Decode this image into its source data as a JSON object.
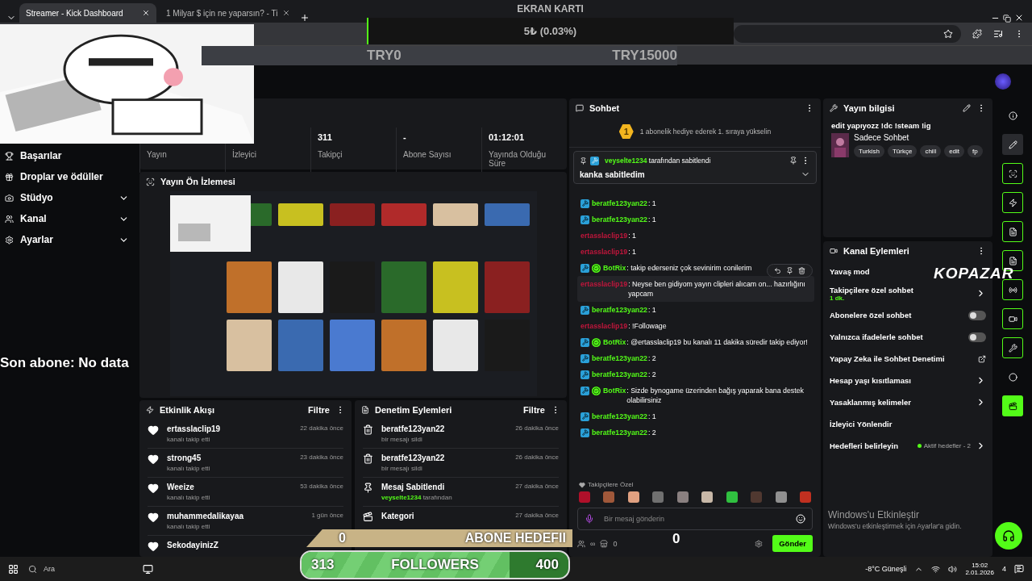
{
  "browser": {
    "tabs": [
      {
        "title": "Streamer - Kick Dashboard",
        "selected": true
      },
      {
        "title": "1 Milyar $ için ne yaparsın? - Ti",
        "selected": false
      }
    ]
  },
  "overlay": {
    "gpu_title": "EKRAN KARTI",
    "gpu_amount": "5₺ (0.03%)",
    "gpu_bar": {
      "level": 0.003
    },
    "min": "TRY0",
    "max": "TRY15000",
    "last_sub": "Son abone: No data",
    "sub_count": "0",
    "sub_label": "ABONE HEDEFII",
    "follow_count": "313",
    "follow_label": "FOLLOWERS",
    "follow_target": "400",
    "follow_bar": {
      "level": 0.78
    },
    "counter": "0",
    "sponsor": "KOPAZAR"
  },
  "sidebar": {
    "items": [
      {
        "label": "Başarılar",
        "expandable": false
      },
      {
        "label": "Droplar ve ödüller",
        "expandable": false
      },
      {
        "label": "Stüdyo",
        "expandable": true
      },
      {
        "label": "Kanal",
        "expandable": true
      },
      {
        "label": "Ayarlar",
        "expandable": true
      }
    ]
  },
  "stats": [
    {
      "label": "Yayın"
    },
    {
      "label": "İzleyici"
    },
    {
      "value": "311",
      "label": "Takipçi"
    },
    {
      "value": "-",
      "label": "Abone Sayısı"
    },
    {
      "value": "01:12:01",
      "label": "Yayında Olduğu Süre"
    }
  ],
  "preview": {
    "title": "Yayın Ön İzlemesi",
    "kind": "picture"
  },
  "events": {
    "title": "Etkinlik Akışı",
    "filter": "Filtre",
    "items": [
      {
        "user": "ertasslaclip19",
        "action": "kanalı takip etti",
        "time": "22 dakika önce"
      },
      {
        "user": "strong45",
        "action": "kanalı takip etti",
        "time": "23 dakika önce"
      },
      {
        "user": "Weeize",
        "action": "kanalı takip etti",
        "time": "53 dakika önce"
      },
      {
        "user": "muhammedalikayaa",
        "action": "kanalı takip etti",
        "time": "1 gün önce"
      },
      {
        "user": "SekodayinizZ"
      }
    ]
  },
  "moderation": {
    "title": "Denetim Eylemleri",
    "filter": "Filtre",
    "items": [
      {
        "kind": "delete",
        "title": "beratfe123yan22",
        "detail": "bir mesajı sildi",
        "time": "26 dakika önce"
      },
      {
        "kind": "delete",
        "title": "beratfe123yan22",
        "detail": "bir mesajı sildi",
        "time": "26 dakika önce"
      },
      {
        "kind": "pin",
        "title": "Mesaj Sabitlendi",
        "user": "veyselte1234",
        "detail": "tarafından",
        "time": "27 dakika önce"
      },
      {
        "kind": "category",
        "title": "Kategori",
        "time": "27 dakika önce"
      }
    ]
  },
  "chat": {
    "title": "Sohbet",
    "rank": "1",
    "rank_text": "1 abonelik hediye ederek 1. sıraya yükselin",
    "pinned": {
      "user": "veyselte1234",
      "suffix": "tarafından sabitlendi",
      "text": "kanka sabitledim"
    },
    "messages": [
      {
        "user": "beratfe123yan22",
        "text": ": 1",
        "color": "#53fc18",
        "mod": true,
        "verified": false,
        "hovered": false
      },
      {
        "user": "beratfe123yan22",
        "text": ": 1",
        "color": "#53fc18",
        "mod": true,
        "verified": false,
        "hovered": false
      },
      {
        "user": "ertasslaclip19",
        "text": ": 1",
        "color": "#c0163c",
        "mod": false,
        "verified": false,
        "hovered": false
      },
      {
        "user": "ertasslaclip19",
        "text": ": 1",
        "color": "#c0163c",
        "mod": false,
        "verified": false,
        "hovered": false
      },
      {
        "user": "BotRix",
        "text": ": takip ederseniz çok sevinirim conilerim",
        "color": "#53fc18",
        "mod": true,
        "verified": true,
        "hovered": false
      },
      {
        "user": "ertasslaclip19",
        "text": ": Neyse ben gidiyom yayın clipleri alıcam on... hazırlığını yapcam",
        "color": "#c0163c",
        "mod": false,
        "verified": false,
        "hovered": true
      },
      {
        "user": "beratfe123yan22",
        "text": ": 1",
        "color": "#53fc18",
        "mod": true,
        "verified": false,
        "hovered": false
      },
      {
        "user": "ertasslaclip19",
        "text": ": !Followage",
        "color": "#c0163c",
        "mod": false,
        "verified": false,
        "hovered": false
      },
      {
        "user": "BotRix",
        "text": ": @ertasslaclip19 bu kanalı 11 dakika süredir takip ediyor!",
        "color": "#53fc18",
        "mod": true,
        "verified": true,
        "hovered": false
      },
      {
        "user": "beratfe123yan22",
        "text": ": 2",
        "color": "#53fc18",
        "mod": true,
        "verified": false,
        "hovered": false
      },
      {
        "user": "beratfe123yan22",
        "text": ": 2",
        "color": "#53fc18",
        "mod": true,
        "verified": false,
        "hovered": false
      },
      {
        "user": "BotRix",
        "text": ": Sizde bynogame üzerinden bağış yaparak bana destek olabilirsiniz",
        "color": "#53fc18",
        "mod": true,
        "verified": true,
        "hovered": false
      },
      {
        "user": "beratfe123yan22",
        "text": ": 1",
        "color": "#53fc18",
        "mod": true,
        "verified": false,
        "hovered": false
      },
      {
        "user": "beratfe123yan22",
        "text": ": 2",
        "color": "#53fc18",
        "mod": true,
        "verified": false,
        "hovered": false
      }
    ],
    "emotes_title": "Takipçilere Özel",
    "emotes": [
      {
        "color": "#b0102a"
      },
      {
        "color": "#a0583a"
      },
      {
        "color": "#e0a080"
      },
      {
        "color": "#707070"
      },
      {
        "color": "#8a8080"
      },
      {
        "color": "#c8b8a8"
      },
      {
        "color": "#30c040"
      },
      {
        "color": "#503830"
      },
      {
        "color": "#909090"
      },
      {
        "color": "#c03020"
      }
    ],
    "placeholder": "Bir mesaj gönderin",
    "points": "∞",
    "shop_count": "0",
    "send": "Gönder"
  },
  "stream_info": {
    "title": "Yayın bilgisi",
    "stream_title": "edit yapıyozz !dc !steam !ig",
    "category": "Sadece Sohbet",
    "tags": [
      "Turkish",
      "Türkçe",
      "chill",
      "edit",
      "fp"
    ]
  },
  "channel_actions": {
    "title": "Kanal Eylemleri",
    "items": [
      {
        "kind": "plain",
        "label": "Yavaş mod"
      },
      {
        "kind": "link",
        "label": "Takipçilere özel sohbet",
        "sub": "1 dk."
      },
      {
        "kind": "toggle",
        "label": "Abonelere özel sohbet",
        "on": false
      },
      {
        "kind": "toggle",
        "label": "Yalnızca ifadelerle sohbet",
        "on": false
      },
      {
        "kind": "external",
        "label": "Yapay Zeka ile Sohbet Denetimi"
      },
      {
        "kind": "link",
        "label": "Hesap yaşı kısıtlaması"
      },
      {
        "kind": "link",
        "label": "Yasaklanmış kelimeler"
      },
      {
        "kind": "plain",
        "label": "İzleyici Yönlendir"
      },
      {
        "kind": "link",
        "label": "Hedefleri belirleyin",
        "status": "Aktif hedefler - 2"
      }
    ]
  },
  "rail": [
    {
      "kind": "plain"
    },
    {
      "kind": "filled"
    },
    {
      "kind": "outlined"
    },
    {
      "kind": "outlined"
    },
    {
      "kind": "outlined"
    },
    {
      "kind": "outlined"
    },
    {
      "kind": "outlined"
    },
    {
      "kind": "outlined"
    },
    {
      "kind": "outlined"
    },
    {
      "kind": "plain"
    },
    {
      "kind": "active"
    }
  ],
  "windows_notice": {
    "title": "Windows'u Etkinleştir",
    "text": "Windows'u etkinleştirmek için Ayarlar'a gidin."
  },
  "taskbar": {
    "search": "Ara",
    "weather": "-8°C  Güneşli",
    "time": "15:02",
    "date": "2.01.2026",
    "notifications": "4"
  }
}
